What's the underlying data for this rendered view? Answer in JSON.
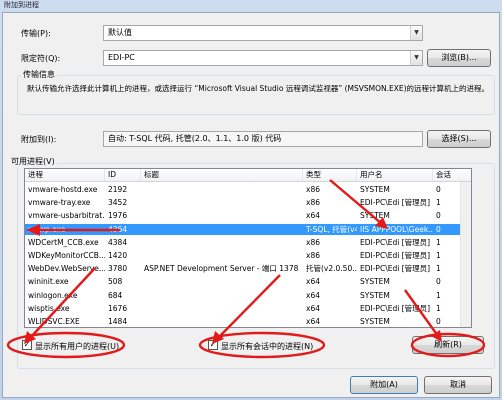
{
  "window": {
    "title": "附加到进程"
  },
  "transport": {
    "label": "传输(P):",
    "value": "默认值"
  },
  "qualifier": {
    "label": "限定符(Q):",
    "value": "EDI-PC",
    "browse_label": "浏览(B)..."
  },
  "transport_info": {
    "title": "传输信息",
    "text": "默认传输允许选择此计算机上的进程，或选择运行 “Microsoft Visual Studio 远程调试监视器” (MSVSMON.EXE)的远程计算机上的进程。"
  },
  "attach_to": {
    "label": "附加到(I):",
    "value": "自动: T-SQL 代码, 托管(2.0、1.1、1.0 版) 代码",
    "select_label": "选择(S)..."
  },
  "processes": {
    "title": "可用进程(V)",
    "columns": [
      "进程",
      "ID",
      "标题",
      "类型",
      "用户名",
      "会话"
    ],
    "rows": [
      [
        "vmware-hostd.exe",
        "2192",
        "",
        "x86",
        "SYSTEM",
        "0"
      ],
      [
        "vmware-tray.exe",
        "3452",
        "",
        "x86",
        "EDI-PC\\Edi [管理员]",
        "1"
      ],
      [
        "vmware-usbarbitrat...",
        "1976",
        "",
        "x64",
        "SYSTEM",
        "0"
      ],
      [
        "w3wp.exe",
        "4364",
        "",
        "T-SQL, 托管(v4....",
        "IIS APPPOOL\\Geek...",
        "0"
      ],
      [
        "WDCertM_CCB.exe",
        "4384",
        "",
        "x86",
        "EDI-PC\\Edi [管理员]",
        "1"
      ],
      [
        "WDKeyMonitorCCB...",
        "1420",
        "",
        "x86",
        "EDI-PC\\Edi [管理员]",
        "1"
      ],
      [
        "WebDev.WebServe...",
        "3780",
        "ASP.NET Development Server - 端口 1378",
        "托管(v2.0.50...",
        "EDI-PC\\Edi [管理员]",
        "1"
      ],
      [
        "wininit.exe",
        "508",
        "",
        "x64",
        "SYSTEM",
        "0"
      ],
      [
        "winlogon.exe",
        "684",
        "",
        "x64",
        "SYSTEM",
        "1"
      ],
      [
        "wisptis.exe",
        "1676",
        "",
        "x64",
        "EDI-PC\\Edi [管理员]",
        "1"
      ],
      [
        "WLIDSVC.EXE",
        "1484",
        "",
        "x64",
        "SYSTEM",
        "0"
      ]
    ],
    "selected_row": 3
  },
  "options": {
    "show_all_users": "显示所有用户的进程(U)",
    "show_all_sessions": "显示所有会话中的进程(N)",
    "refresh_label": "刷新(R)"
  },
  "footer": {
    "attach_label": "附加(A)",
    "cancel_label": "取消"
  },
  "accent": {
    "annotation_red": "#e21a1a",
    "selection_blue": "#3399ff"
  }
}
